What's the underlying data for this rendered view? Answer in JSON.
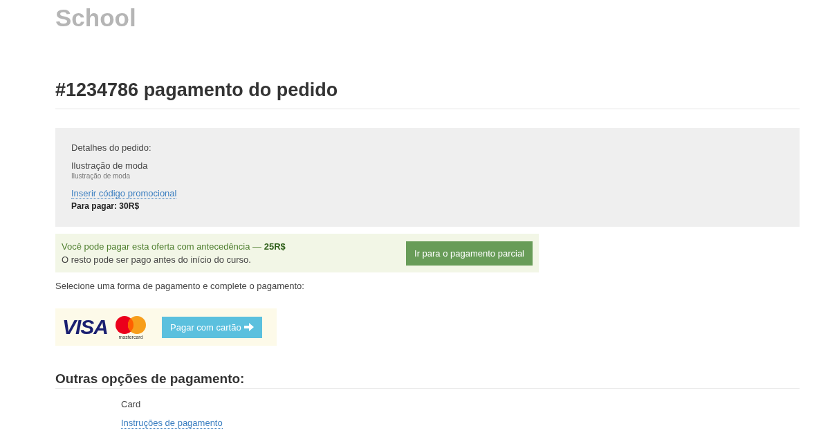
{
  "site_title": "School",
  "heading": "#1234786 pagamento do pedido",
  "order": {
    "label": "Detalhes do pedido:",
    "item_title": "Ilustração de moda",
    "item_subtitle": "Ilustração de moda",
    "promo_link": "Inserir código promocional",
    "total": "Para pagar: 30R$"
  },
  "partial": {
    "line1": "Você pode pagar esta oferta com antecedência — **25R$**",
    "line2": "O resto pode ser pago antes do início do curso.",
    "button": "Ir para o pagamento parcial"
  },
  "select_prompt": "Selecione uma forma de pagamento e complete o pagamento:",
  "card_payment": {
    "visa_logo": "VISA",
    "mastercard_logo": "mastercard",
    "button": "Pagar com cartão"
  },
  "other_options": {
    "heading": "Outras opções de pagamento:",
    "items": [
      {
        "kind": "text",
        "label": "Card"
      },
      {
        "kind": "link",
        "label": "Instruções de pagamento"
      }
    ]
  }
}
